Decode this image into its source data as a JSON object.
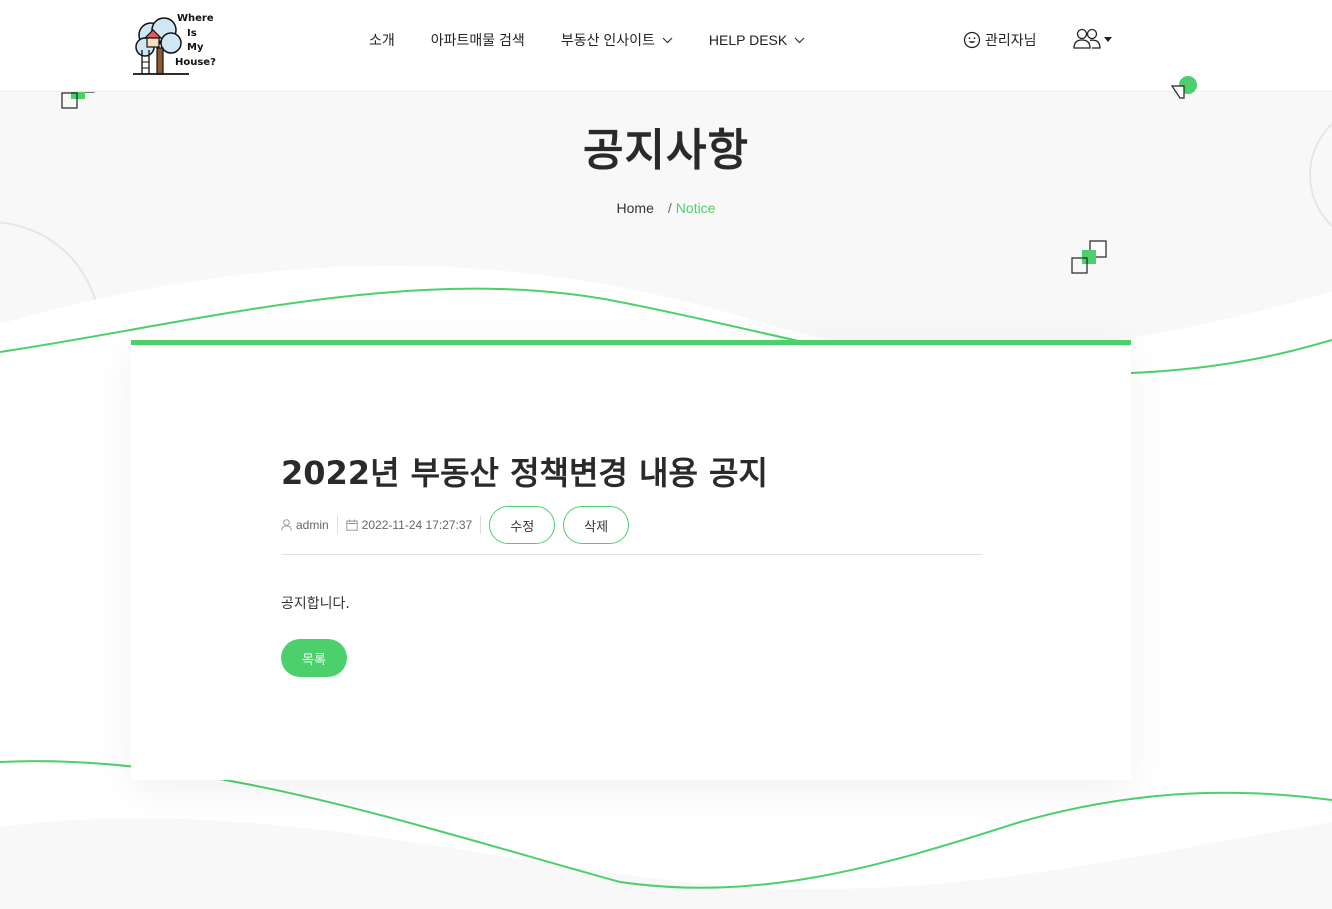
{
  "header": {
    "logo_text": [
      "Where",
      "Is",
      "My",
      "House?"
    ],
    "nav": [
      {
        "label": "소개",
        "dropdown": false
      },
      {
        "label": "아파트매물 검색",
        "dropdown": false
      },
      {
        "label": "부동산 인사이트",
        "dropdown": true
      },
      {
        "label": "HELP DESK",
        "dropdown": true
      }
    ],
    "admin_label": "관리자님"
  },
  "hero": {
    "title": "공지사항",
    "breadcrumb": {
      "home": "Home",
      "separator": "/",
      "current": "Notice"
    }
  },
  "post": {
    "title": "2022년 부동산 정책변경 내용 공지",
    "author": "admin",
    "datetime": "2022-11-24 17:27:37",
    "edit_label": "수정",
    "delete_label": "삭제",
    "body": "공지합니다.",
    "list_label": "목록"
  },
  "colors": {
    "accent": "#4cd06b",
    "background": "#f8f8f8",
    "text": "#333333"
  }
}
